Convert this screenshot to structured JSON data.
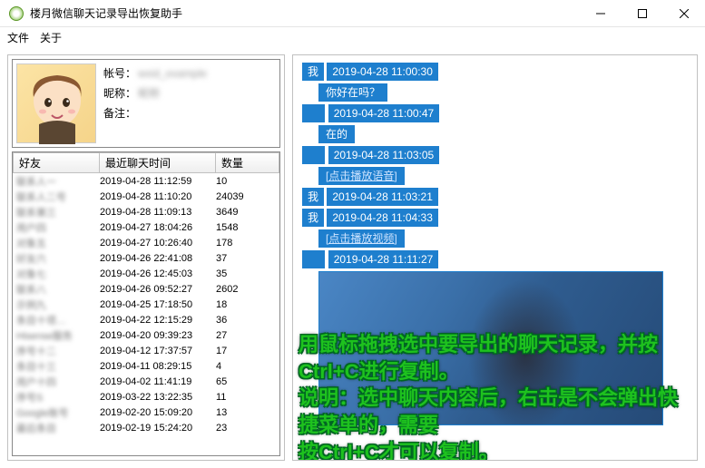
{
  "window": {
    "title": "楼月微信聊天记录导出恢复助手"
  },
  "menu": {
    "file": "文件",
    "about": "关于"
  },
  "profile": {
    "account_label": "帐号：",
    "account_value": "wxid_example",
    "nick_label": "昵称：",
    "nick_value": "昵称",
    "remark_label": "备注："
  },
  "columns": {
    "friend": "好友",
    "lastchat": "最近聊天时间",
    "count": "数量"
  },
  "contacts": [
    {
      "name": "联系人一",
      "time": "2019-04-28 11:12:59",
      "count": "10"
    },
    {
      "name": "联系人二号",
      "time": "2019-04-28 11:10:20",
      "count": "24039"
    },
    {
      "name": "联系第三",
      "time": "2019-04-28 11:09:13",
      "count": "3649"
    },
    {
      "name": "用户四",
      "time": "2019-04-27 18:04:26",
      "count": "1548"
    },
    {
      "name": "对象五",
      "time": "2019-04-27 10:26:40",
      "count": "178"
    },
    {
      "name": "好友六",
      "time": "2019-04-26 22:41:08",
      "count": "37"
    },
    {
      "name": "对象七",
      "time": "2019-04-26 12:45:03",
      "count": "35"
    },
    {
      "name": "联系八",
      "time": "2019-04-26 09:52:27",
      "count": "2602"
    },
    {
      "name": "示例九",
      "time": "2019-04-25 17:18:50",
      "count": "18"
    },
    {
      "name": "条目十项…",
      "time": "2019-04-22 12:15:29",
      "count": "36"
    },
    {
      "name": "Hisense服务",
      "time": "2019-04-20 09:39:23",
      "count": "27"
    },
    {
      "name": "序号十二",
      "time": "2019-04-12 17:37:57",
      "count": "17"
    },
    {
      "name": "条目十三",
      "time": "2019-04-11 08:29:15",
      "count": "4"
    },
    {
      "name": "用户十四",
      "time": "2019-04-02 11:41:19",
      "count": "65"
    },
    {
      "name": "序号S",
      "time": "2019-03-22 13:22:35",
      "count": "11"
    },
    {
      "name": "Google账号",
      "time": "2019-02-20 15:09:20",
      "count": "13"
    },
    {
      "name": "最后条目",
      "time": "2019-02-19 15:24:20",
      "count": "23"
    }
  ],
  "chat": {
    "me": "我",
    "msgs": [
      {
        "who": "我",
        "ts": "2019-04-28 11:00:30",
        "text": "你好在吗？",
        "type": "text"
      },
      {
        "who": "",
        "ts": "2019-04-28 11:00:47",
        "text": "在的",
        "type": "text"
      },
      {
        "who": "",
        "ts": "2019-04-28 11:03:05",
        "text": "[点击播放语音]",
        "type": "link"
      },
      {
        "who": "我",
        "ts": "2019-04-28 11:03:21",
        "text": "",
        "type": "none"
      },
      {
        "who": "我",
        "ts": "2019-04-28 11:04:33",
        "text": "[点击播放视频]",
        "type": "link"
      },
      {
        "who": "",
        "ts": "2019-04-28 11:11:27",
        "text": "",
        "type": "image"
      }
    ]
  },
  "overlay": {
    "l1": "用鼠标拖拽选中要导出的聊天记录，并按Ctrl+C进行复制。",
    "l2": "说明：选中聊天内容后，右击是不会弹出快捷菜单的，需要",
    "l3": "按Ctrl+C才可以复制。"
  }
}
